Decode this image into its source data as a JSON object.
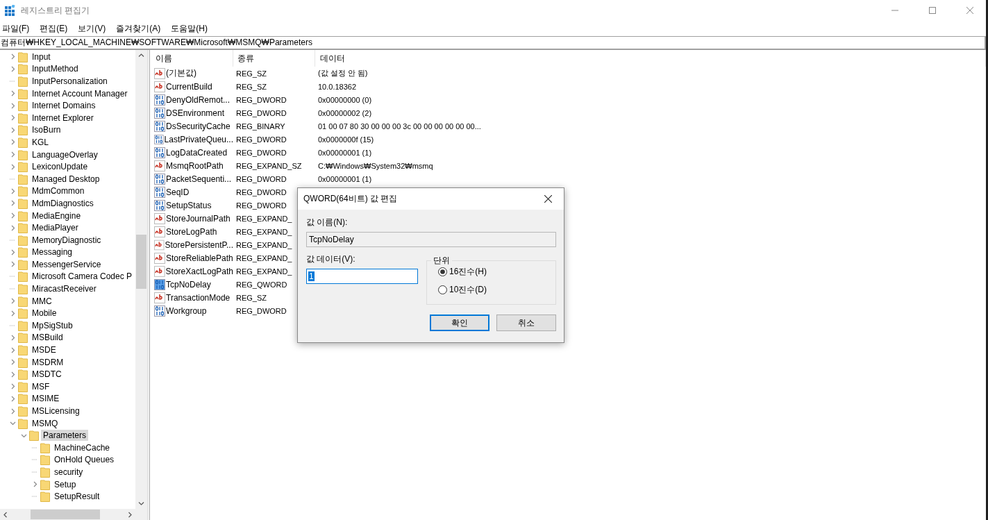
{
  "window": {
    "title": "레지스트리 편집기"
  },
  "menu": [
    "파일(F)",
    "편집(E)",
    "보기(V)",
    "즐겨찾기(A)",
    "도움말(H)"
  ],
  "address": "컴퓨터₩HKEY_LOCAL_MACHINE₩SOFTWARE₩Microsoft₩MSMQ₩Parameters",
  "tree": [
    {
      "label": "Input",
      "expanded": false,
      "selected": false
    },
    {
      "label": "InputMethod",
      "expanded": false,
      "selected": false
    },
    {
      "label": "InputPersonalization",
      "selected": false
    },
    {
      "label": "Internet Account Manager",
      "expanded": false,
      "selected": false
    },
    {
      "label": "Internet Domains",
      "expanded": false,
      "selected": false
    },
    {
      "label": "Internet Explorer",
      "expanded": false,
      "selected": false
    },
    {
      "label": "IsoBurn",
      "expanded": false,
      "selected": false
    },
    {
      "label": "KGL",
      "expanded": false,
      "selected": false
    },
    {
      "label": "LanguageOverlay",
      "expanded": false,
      "selected": false
    },
    {
      "label": "LexiconUpdate",
      "expanded": false,
      "selected": false
    },
    {
      "label": "Managed Desktop",
      "selected": false
    },
    {
      "label": "MdmCommon",
      "expanded": false,
      "selected": false
    },
    {
      "label": "MdmDiagnostics",
      "expanded": false,
      "selected": false
    },
    {
      "label": "MediaEngine",
      "expanded": false,
      "selected": false
    },
    {
      "label": "MediaPlayer",
      "expanded": false,
      "selected": false
    },
    {
      "label": "MemoryDiagnostic",
      "selected": false
    },
    {
      "label": "Messaging",
      "expanded": false,
      "selected": false
    },
    {
      "label": "MessengerService",
      "expanded": false,
      "selected": false
    },
    {
      "label": "Microsoft Camera Codec P",
      "selected": false
    },
    {
      "label": "MiracastReceiver",
      "selected": false
    },
    {
      "label": "MMC",
      "expanded": false,
      "selected": false
    },
    {
      "label": "Mobile",
      "expanded": false,
      "selected": false
    },
    {
      "label": "MpSigStub",
      "selected": false
    },
    {
      "label": "MSBuild",
      "expanded": false,
      "selected": false
    },
    {
      "label": "MSDE",
      "expanded": false,
      "selected": false
    },
    {
      "label": "MSDRM",
      "expanded": false,
      "selected": false
    },
    {
      "label": "MSDTC",
      "expanded": false,
      "selected": false
    },
    {
      "label": "MSF",
      "expanded": false,
      "selected": false
    },
    {
      "label": "MSIME",
      "expanded": false,
      "selected": false
    },
    {
      "label": "MSLicensing",
      "expanded": false,
      "selected": false
    },
    {
      "label": "MSMQ",
      "expanded": true,
      "selected": false,
      "children": [
        {
          "label": "Parameters",
          "expanded": true,
          "selected": true,
          "children": [
            {
              "label": "MachineCache",
              "selected": false
            },
            {
              "label": "OnHold Queues",
              "selected": false
            },
            {
              "label": "security",
              "selected": false
            },
            {
              "label": "Setup",
              "expanded": false,
              "selected": false
            },
            {
              "label": "SetupResult",
              "selected": false
            }
          ]
        }
      ]
    }
  ],
  "values": {
    "columns": [
      "이름",
      "종류",
      "데이터"
    ],
    "rows": [
      {
        "kind": "string",
        "name": "(기본값)",
        "type": "REG_SZ",
        "data": "(값 설정 안 됨)",
        "selected": false
      },
      {
        "kind": "string",
        "name": "CurrentBuild",
        "type": "REG_SZ",
        "data": "10.0.18362",
        "selected": false
      },
      {
        "kind": "binary",
        "name": "DenyOldRemot...",
        "type": "REG_DWORD",
        "data": "0x00000000 (0)",
        "selected": false
      },
      {
        "kind": "binary",
        "name": "DSEnvironment",
        "type": "REG_DWORD",
        "data": "0x00000002 (2)",
        "selected": false
      },
      {
        "kind": "binary",
        "name": "DsSecurityCache",
        "type": "REG_BINARY",
        "data": "01 00 07 80 30 00 00 00 3c 00 00 00 00 00 00...",
        "selected": false
      },
      {
        "kind": "binary",
        "name": "LastPrivateQueu...",
        "type": "REG_DWORD",
        "data": "0x0000000f (15)",
        "selected": false
      },
      {
        "kind": "binary",
        "name": "LogDataCreated",
        "type": "REG_DWORD",
        "data": "0x00000001 (1)",
        "selected": false
      },
      {
        "kind": "string",
        "name": "MsmqRootPath",
        "type": "REG_EXPAND_SZ",
        "data": "C:₩Windows₩System32₩msmq",
        "selected": false
      },
      {
        "kind": "binary",
        "name": "PacketSequenti...",
        "type": "REG_DWORD",
        "data": "0x00000001 (1)",
        "selected": false
      },
      {
        "kind": "binary",
        "name": "SeqID",
        "type": "REG_DWORD",
        "selected": false
      },
      {
        "kind": "binary",
        "name": "SetupStatus",
        "type": "REG_DWORD",
        "selected": false
      },
      {
        "kind": "string",
        "name": "StoreJournalPath",
        "type": "REG_EXPAND_",
        "selected": false
      },
      {
        "kind": "string",
        "name": "StoreLogPath",
        "type": "REG_EXPAND_",
        "selected": false
      },
      {
        "kind": "string",
        "name": "StorePersistentP...",
        "type": "REG_EXPAND_",
        "selected": false
      },
      {
        "kind": "string",
        "name": "StoreReliablePath",
        "type": "REG_EXPAND_",
        "selected": false
      },
      {
        "kind": "string",
        "name": "StoreXactLogPath",
        "type": "REG_EXPAND_",
        "selected": false
      },
      {
        "kind": "binary",
        "name": "TcpNoDelay",
        "type": "REG_QWORD",
        "selected": true
      },
      {
        "kind": "string",
        "name": "TransactionMode",
        "type": "REG_SZ",
        "selected": false
      },
      {
        "kind": "binary",
        "name": "Workgroup",
        "type": "REG_DWORD",
        "selected": false
      }
    ]
  },
  "dialog": {
    "title": "QWORD(64비트) 값 편집",
    "name_label": "값 이름(N):",
    "name_value": "TcpNoDelay",
    "data_label": "값 데이터(V):",
    "data_value": "1",
    "group_title": "단위",
    "radios": [
      {
        "label": "16진수(H)",
        "selected": true
      },
      {
        "label": "10진수(D)",
        "selected": false
      }
    ],
    "buttons": [
      {
        "label": "확인",
        "default": true
      },
      {
        "label": "취소",
        "default": false
      }
    ]
  }
}
